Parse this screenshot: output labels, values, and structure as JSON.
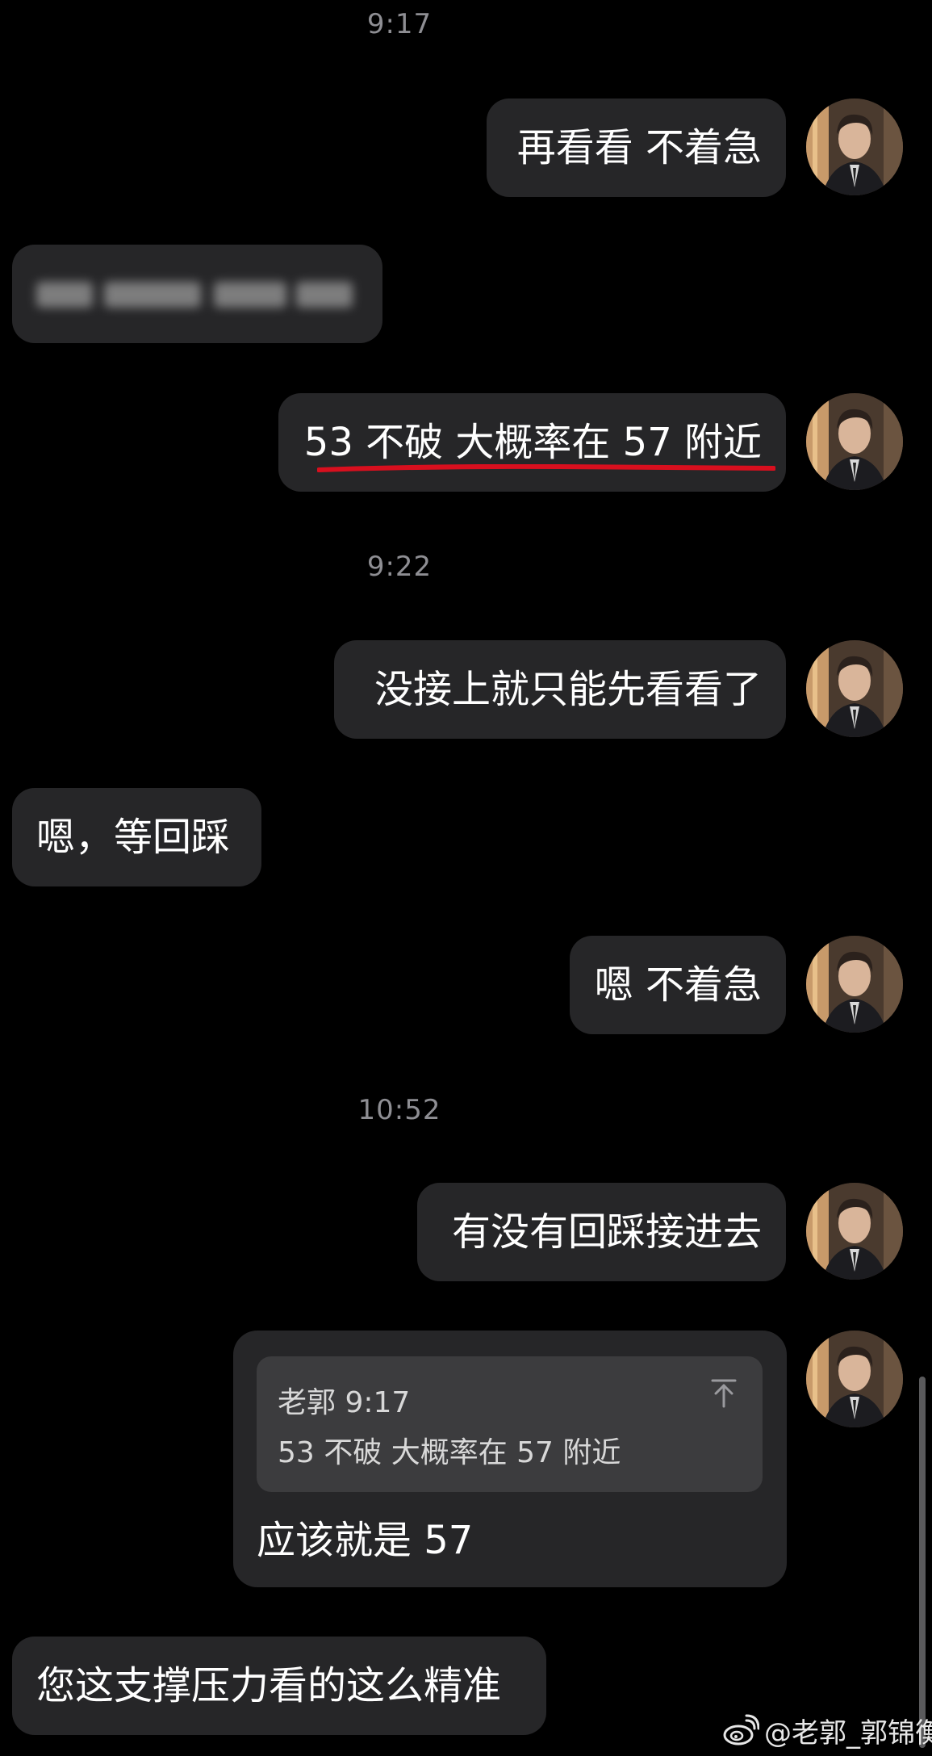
{
  "timestamps": {
    "t1": "9:17",
    "t2": "9:22",
    "t3": "10:52"
  },
  "messages": {
    "m1": "再看看 不着急",
    "m3": "53 不破 大概率在 57 附近",
    "m4": "没接上就只能先看看了",
    "m5": "嗯，等回踩",
    "m6": "嗯 不着急",
    "m7": "有没有回踩接进去",
    "m9": "您这支撑压力看的这么精准"
  },
  "quote": {
    "meta": "老郭 9:17",
    "text": "53 不破 大概率在 57 附近",
    "reply": "应该就是 57",
    "jump_icon": "arrow-up-to-top-icon"
  },
  "watermark": {
    "text": "@老郭_郭锦衡",
    "icon": "weibo-icon"
  },
  "colors": {
    "background": "#000000",
    "bubble": "#262628",
    "quote_box": "#3c3c3e",
    "timestamp": "#8e8e93",
    "underline": "#d80f1e"
  }
}
